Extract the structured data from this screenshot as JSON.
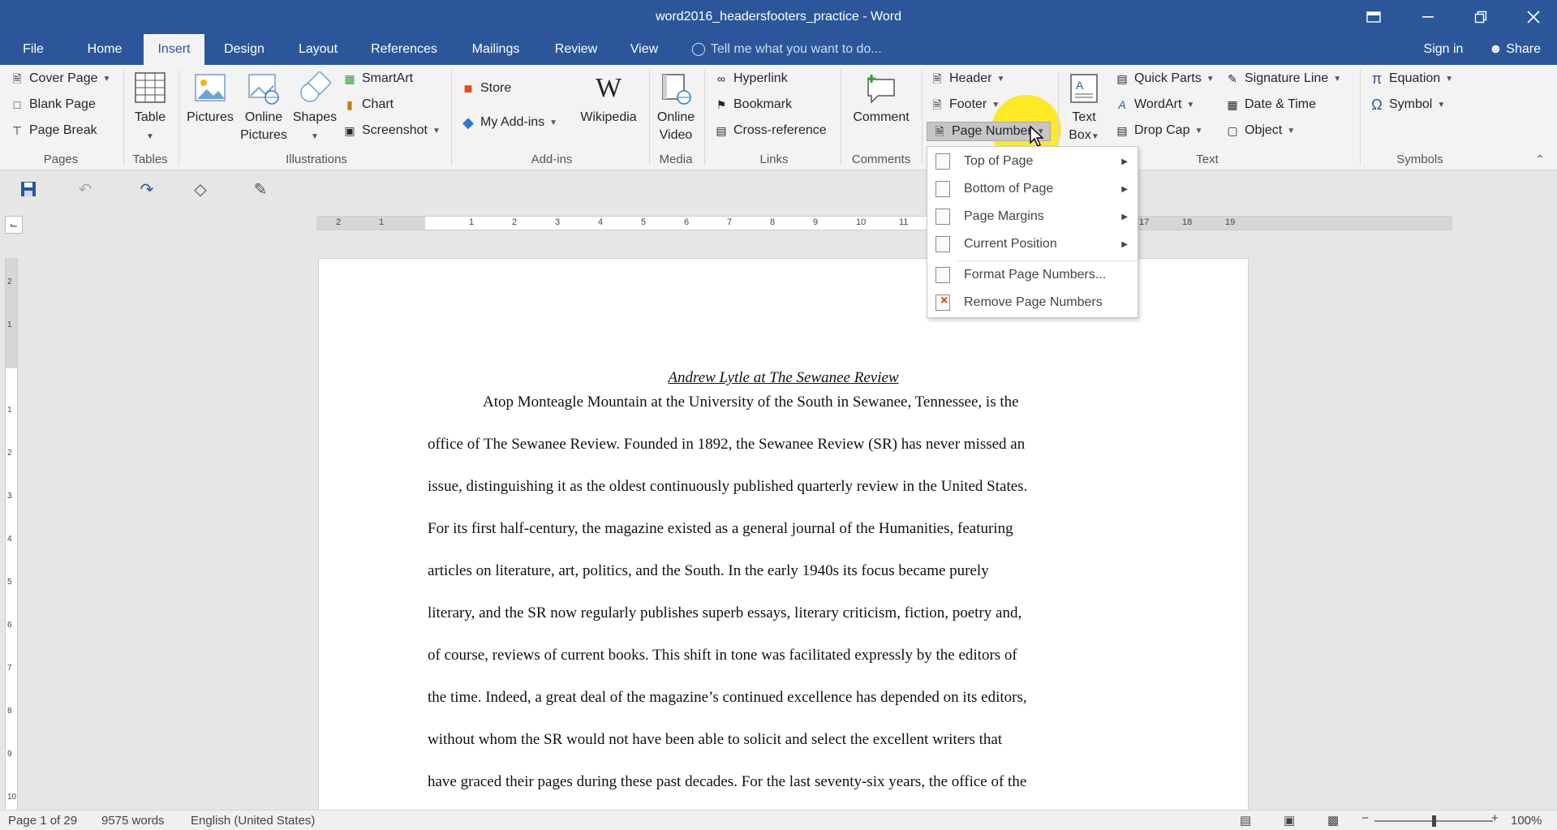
{
  "window": {
    "title": "word2016_headersfooters_practice - Word"
  },
  "tabs": [
    "File",
    "Home",
    "Insert",
    "Design",
    "Layout",
    "References",
    "Mailings",
    "Review",
    "View"
  ],
  "active_tab": "Insert",
  "tellme_placeholder": "Tell me what you want to do...",
  "signin": "Sign in",
  "share": "Share",
  "ribbon": {
    "pages": {
      "label": "Pages",
      "cover_page": "Cover Page",
      "blank_page": "Blank Page",
      "page_break": "Page Break"
    },
    "tables": {
      "label": "Tables",
      "table": "Table"
    },
    "illustrations": {
      "label": "Illustrations",
      "pictures": "Pictures",
      "online_pictures_1": "Online",
      "online_pictures_2": "Pictures",
      "shapes": "Shapes",
      "smartart": "SmartArt",
      "chart": "Chart",
      "screenshot": "Screenshot"
    },
    "addins": {
      "label": "Add-ins",
      "store": "Store",
      "my_addins": "My Add-ins",
      "wikipedia": "Wikipedia"
    },
    "media": {
      "label": "Media",
      "online_video_1": "Online",
      "online_video_2": "Video"
    },
    "links": {
      "label": "Links",
      "hyperlink": "Hyperlink",
      "bookmark": "Bookmark",
      "cross_reference": "Cross-reference"
    },
    "comments": {
      "label": "Comments",
      "comment": "Comment"
    },
    "header_footer": {
      "header": "Header",
      "footer": "Footer",
      "page_number": "Page Number"
    },
    "text": {
      "label": "Text",
      "text_box_1": "Text",
      "text_box_2": "Box",
      "quick_parts": "Quick Parts",
      "wordart": "WordArt",
      "drop_cap": "Drop Cap",
      "signature_line": "Signature Line",
      "date_time": "Date & Time",
      "object": "Object"
    },
    "symbols": {
      "label": "Symbols",
      "equation": "Equation",
      "symbol": "Symbol"
    }
  },
  "page_number_menu": {
    "items": [
      {
        "label": "Top of Page",
        "submenu": true
      },
      {
        "label": "Bottom of Page",
        "submenu": true
      },
      {
        "label": "Page Margins",
        "submenu": true
      },
      {
        "label": "Current Position",
        "submenu": true
      },
      {
        "label": "Format Page Numbers...",
        "submenu": false
      },
      {
        "label": "Remove Page Numbers",
        "submenu": false
      }
    ]
  },
  "ruler": {
    "h_left_marks": [
      "2",
      "1"
    ],
    "h_marks": [
      "1",
      "2",
      "3",
      "4",
      "5",
      "6",
      "7",
      "8",
      "9",
      "10",
      "11"
    ],
    "h_right_marks": [
      "17",
      "18",
      "19"
    ],
    "v_marks": [
      "2",
      "1",
      "1",
      "2",
      "3",
      "4",
      "5",
      "6",
      "7",
      "8",
      "9",
      "10"
    ]
  },
  "document": {
    "title": "Andrew Lytle at The Sewanee Review",
    "lines": [
      "Atop Monteagle Mountain at the University of the South in Sewanee, Tennessee, is the",
      "office of The Sewanee Review. Founded in 1892, the Sewanee Review (SR) has never missed an",
      "issue, distinguishing it as the oldest continuously published quarterly review in the United States.",
      "For its first half-century, the magazine existed as a general journal of the Humanities, featuring",
      "articles on literature, art, politics, and the South. In the early 1940s its focus became purely",
      "literary, and the SR now regularly publishes superb essays, literary criticism, fiction, poetry and,",
      "of course, reviews of current books. This shift in tone was facilitated expressly by the editors of",
      "the time. Indeed, a great deal of the magazine’s continued excellence has depended on its editors,",
      "without whom the SR would not have been able to solicit and select the excellent writers that",
      "have graced their pages during these past decades. For the last seventy-six years, the office of the"
    ]
  },
  "status": {
    "page": "Page 1 of 29",
    "words": "9575 words",
    "language": "English (United States)",
    "zoom": "100%",
    "zoom_level": 1.0
  },
  "colors": {
    "titlebar": "#2b579a",
    "ribbon": "#f3f3f3",
    "highlight": "#ffe600"
  }
}
